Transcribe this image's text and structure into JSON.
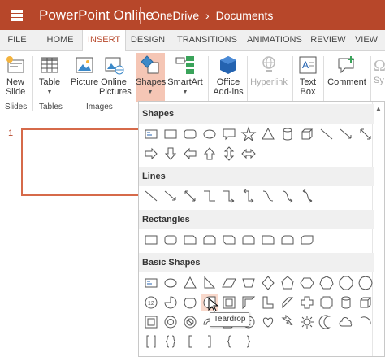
{
  "header": {
    "app_title": "PowerPoint Online",
    "breadcrumb": [
      "OneDrive",
      "›",
      "Documents"
    ],
    "bg_color": "#b7472a"
  },
  "tabs": [
    {
      "label": "FILE",
      "active": false
    },
    {
      "label": "HOME",
      "active": false
    },
    {
      "label": "INSERT",
      "active": true
    },
    {
      "label": "DESIGN",
      "active": false
    },
    {
      "label": "TRANSITIONS",
      "active": false
    },
    {
      "label": "ANIMATIONS",
      "active": false
    },
    {
      "label": "REVIEW",
      "active": false
    },
    {
      "label": "VIEW",
      "active": false
    }
  ],
  "ribbon": {
    "buttons": {
      "new_slide": {
        "label1": "New",
        "label2": "Slide"
      },
      "table": {
        "label": "Table"
      },
      "picture": {
        "label": "Picture"
      },
      "online_pictures": {
        "label1": "Online",
        "label2": "Pictures"
      },
      "shapes": {
        "label": "Shapes"
      },
      "smartart": {
        "label": "SmartArt"
      },
      "office_addins": {
        "label1": "Office",
        "label2": "Add-ins"
      },
      "hyperlink": {
        "label": "Hyperlink"
      },
      "text_box": {
        "label1": "Text",
        "label2": "Box"
      },
      "comment": {
        "label": "Comment"
      },
      "symbol": {
        "label": "Sy"
      }
    },
    "groups": {
      "slides": "Slides",
      "tables": "Tables",
      "images": "Images"
    }
  },
  "slide_pane": {
    "slide_number": "1"
  },
  "shapes_menu": {
    "sections": {
      "shapes": "Shapes",
      "lines": "Lines",
      "rectangles": "Rectangles",
      "basic_shapes": "Basic Shapes"
    },
    "tooltip": "Teardrop"
  }
}
